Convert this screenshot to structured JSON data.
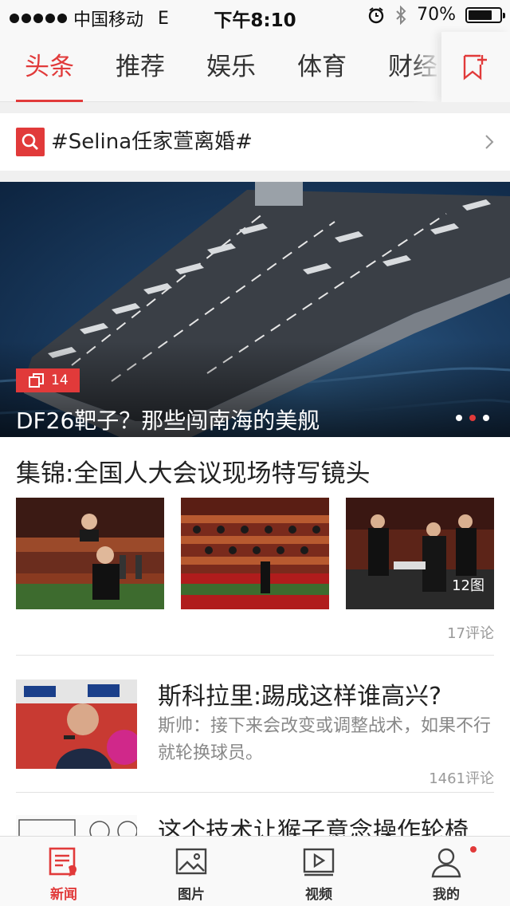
{
  "status_bar": {
    "carrier": "中国移动",
    "network": "E",
    "time": "下午8:10",
    "battery": "70%",
    "battery_level": 0.7
  },
  "channels": [
    {
      "label": "头条",
      "active": true
    },
    {
      "label": "推荐",
      "active": false
    },
    {
      "label": "娱乐",
      "active": false
    },
    {
      "label": "体育",
      "active": false
    },
    {
      "label": "财经",
      "active": false
    }
  ],
  "topic": {
    "text": "#Selina任家萱离婚#"
  },
  "banner": {
    "image_count": "14",
    "title": "DF26靶子？那些闯南海的美舰",
    "pager_dots": 3,
    "pager_active": 1
  },
  "gallery_article": {
    "title": "集锦:全国人大会议现场特写镜头",
    "pics_label": "12图",
    "comments": "17评论"
  },
  "article2": {
    "title": "斯科拉里:踢成这样谁高兴?",
    "desc": "斯帅：接下来会改变或调整战术，如果不行就轮换球员。",
    "comments": "1461评论"
  },
  "article3": {
    "title": "这个技术让猴子意念操作轮椅"
  },
  "bottom_nav": [
    {
      "label": "新闻",
      "icon": "news-icon",
      "active": true
    },
    {
      "label": "图片",
      "icon": "picture-icon",
      "active": false
    },
    {
      "label": "视频",
      "icon": "video-icon",
      "active": false
    },
    {
      "label": "我的",
      "icon": "profile-icon",
      "active": false,
      "badge": true
    }
  ],
  "colors": {
    "accent": "#e13a3a",
    "text": "#222222",
    "muted": "#999999",
    "sea": "#1c3e63"
  }
}
